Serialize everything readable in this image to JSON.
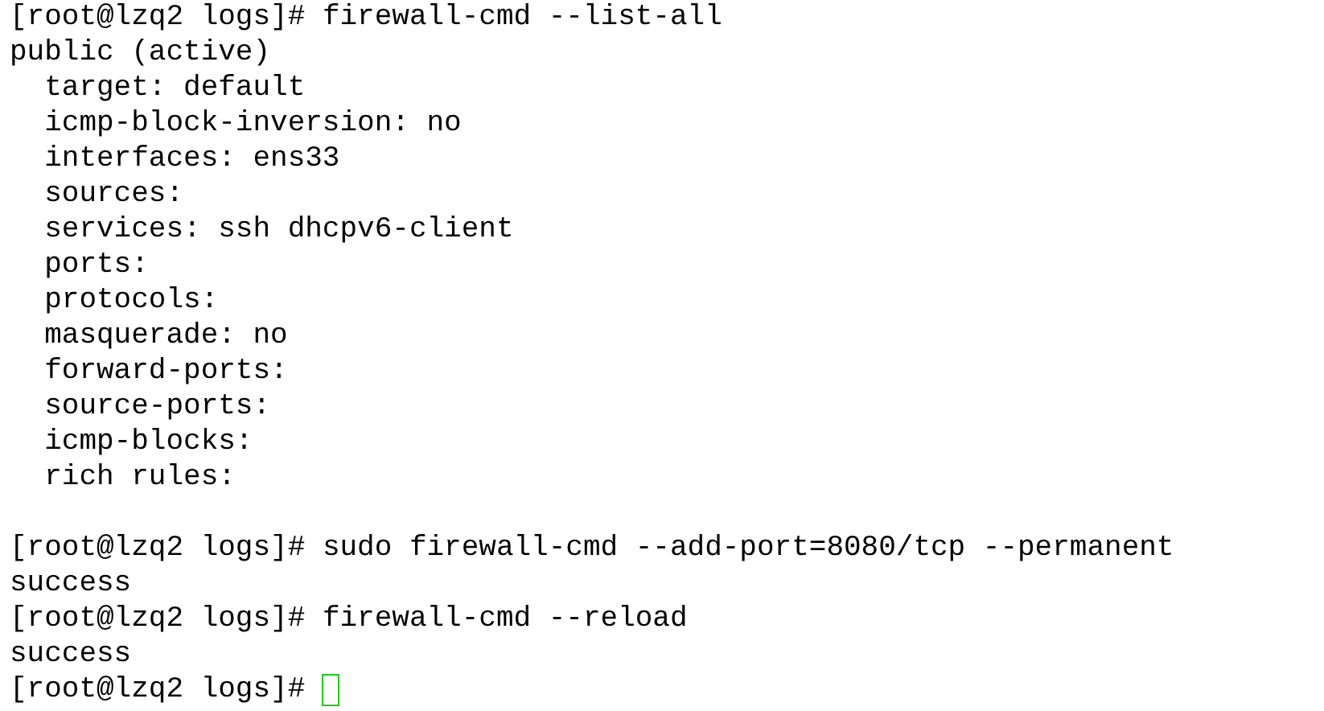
{
  "terminal": {
    "lines": [
      {
        "kind": "command",
        "prompt": "[root@lzq2 logs]#",
        "command": "firewall-cmd --list-all"
      },
      {
        "kind": "output",
        "text": "public (active)"
      },
      {
        "kind": "output",
        "text": "  target: default"
      },
      {
        "kind": "output",
        "text": "  icmp-block-inversion: no"
      },
      {
        "kind": "output",
        "text": "  interfaces: ens33"
      },
      {
        "kind": "output",
        "text": "  sources:"
      },
      {
        "kind": "output",
        "text": "  services: ssh dhcpv6-client"
      },
      {
        "kind": "output",
        "text": "  ports:"
      },
      {
        "kind": "output",
        "text": "  protocols:"
      },
      {
        "kind": "output",
        "text": "  masquerade: no"
      },
      {
        "kind": "output",
        "text": "  forward-ports:"
      },
      {
        "kind": "output",
        "text": "  source-ports:"
      },
      {
        "kind": "output",
        "text": "  icmp-blocks:"
      },
      {
        "kind": "output",
        "text": "  rich rules:"
      },
      {
        "kind": "blank"
      },
      {
        "kind": "command",
        "prompt": "[root@lzq2 logs]#",
        "command": "sudo firewall-cmd --add-port=8080/tcp --permanent"
      },
      {
        "kind": "output",
        "text": "success"
      },
      {
        "kind": "command",
        "prompt": "[root@lzq2 logs]#",
        "command": "firewall-cmd --reload"
      },
      {
        "kind": "output",
        "text": "success"
      },
      {
        "kind": "command",
        "prompt": "[root@lzq2 logs]#",
        "cursor": true
      }
    ]
  }
}
